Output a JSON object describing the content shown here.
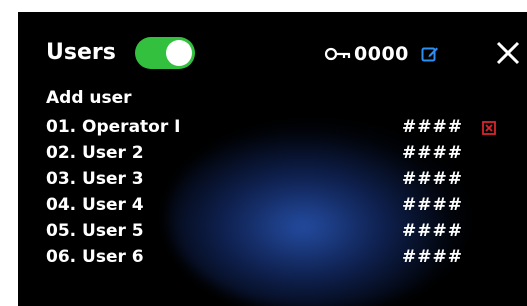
{
  "header": {
    "title": "Users",
    "toggle_on": true,
    "key_code": "0000"
  },
  "add_user_label": "Add user",
  "users": [
    {
      "label": "01. Operator I",
      "pin": "####",
      "deletable": true
    },
    {
      "label": "02. User 2",
      "pin": "####"
    },
    {
      "label": "03. User 3",
      "pin": "####"
    },
    {
      "label": "04. User 4",
      "pin": "####"
    },
    {
      "label": "05. User 5",
      "pin": "####"
    },
    {
      "label": "06. User 6",
      "pin": "####"
    }
  ],
  "icons": {
    "key": "key-icon",
    "edit": "edit-icon",
    "close": "close-icon",
    "delete": "delete-icon"
  },
  "colors": {
    "toggle_active": "#33c03e",
    "edit_accent": "#2f8ef0",
    "delete_accent": "#d8252d",
    "background": "#000000"
  }
}
